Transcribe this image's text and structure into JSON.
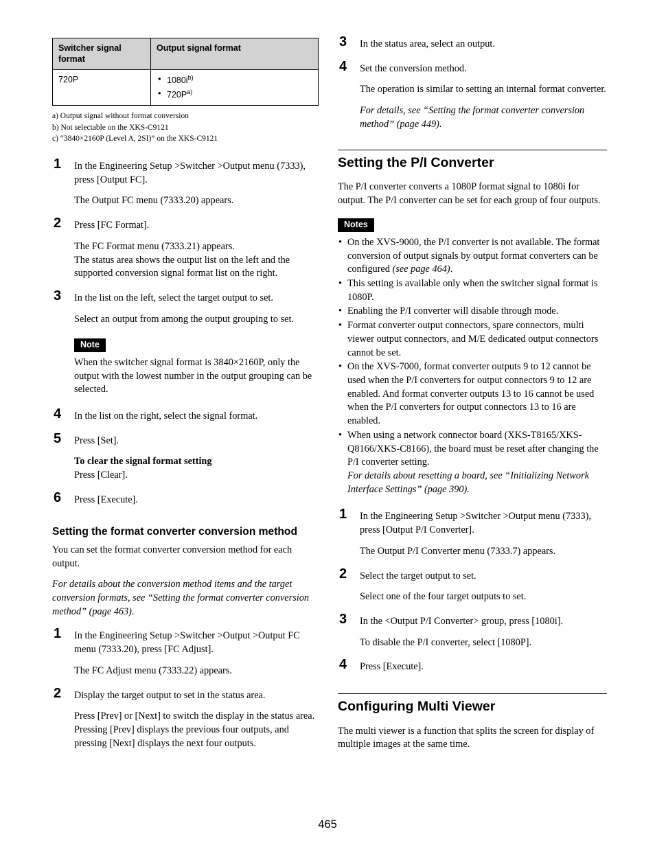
{
  "page_number": "465",
  "table": {
    "headers": [
      "Switcher signal format",
      "Output signal format"
    ],
    "rows": [
      {
        "format": "720P",
        "outputs": [
          {
            "label": "1080i",
            "footnote": "b)"
          },
          {
            "label": "720P",
            "footnote": "a)"
          }
        ]
      }
    ]
  },
  "footnotes": [
    "a) Output signal without format conversion",
    "b) Not selectable on the XKS-C9121",
    "c) “3840×2160P (Level A, 2SI)” on the XKS-C9121"
  ],
  "left_column": {
    "steps_fc_format": [
      {
        "num": "1",
        "text": "In the Engineering Setup >Switcher >Output menu (7333), press [Output FC].",
        "result": "The Output FC menu (7333.20) appears."
      },
      {
        "num": "2",
        "text": "Press [FC Format].",
        "result": "The FC Format menu (7333.21) appears.\nThe status area shows the output list on the left and the supported conversion signal format list on the right."
      },
      {
        "num": "3",
        "text": "In the list on the left, select the target output to set.",
        "result": "Select an output from among the output grouping to set."
      },
      {
        "num": "4",
        "text": "In the list on the right, select the signal format."
      },
      {
        "num": "5",
        "text": "Press [Set]."
      },
      {
        "num": "6",
        "text": "Press [Execute]."
      }
    ],
    "note": {
      "badge": "Note",
      "body": "When the switcher signal format is 3840×2160P, only the output with the lowest number in the output grouping can be selected."
    },
    "clear_setting": {
      "heading": "To clear the signal format setting",
      "body": "Press [Clear]."
    },
    "subsection": {
      "heading": "Setting the format converter conversion method",
      "intro": "You can set the format converter conversion method for each output.",
      "reference": "For details about the conversion method items and the target conversion formats, see “Setting the format converter conversion method” (page 463).",
      "steps": [
        {
          "num": "1",
          "text": "In the Engineering Setup >Switcher >Output >Output FC menu (7333.20), press [FC Adjust].",
          "result": "The FC Adjust menu (7333.22) appears."
        },
        {
          "num": "2",
          "text": "Display the target output to set in the status area.",
          "result": "Press [Prev] or [Next] to switch the display in the status area.\nPressing [Prev] displays the previous four outputs, and pressing [Next] displays the next four outputs."
        }
      ]
    }
  },
  "right_column": {
    "steps_continued": [
      {
        "num": "3",
        "text": "In the status area, select an output."
      },
      {
        "num": "4",
        "text": "Set the conversion method.",
        "result": "The operation is similar to setting an internal format converter.",
        "reference": "For details, see “Setting the format converter conversion method” (page 449)."
      }
    ],
    "section_pi": {
      "heading": "Setting the P/I Converter",
      "intro": "The P/I converter converts a 1080P format signal to 1080i for output. The P/I converter can be set for each group of four outputs.",
      "notes_badge": "Notes",
      "notes": [
        {
          "text": "On the XVS-9000, the P/I converter is not available. The format conversion of output signals by output format converters can be configured ",
          "italic_tail": "(see page 464)",
          "tail": "."
        },
        {
          "text": "This setting is available only when the switcher signal format is 1080P."
        },
        {
          "text": "Enabling the P/I converter will disable through mode."
        },
        {
          "text": "Format converter output connectors, spare connectors, multi viewer output connectors, and M/E dedicated output connectors cannot be set."
        },
        {
          "text": "On the XVS-7000, format converter outputs 9 to 12 cannot be used when the P/I converters for output connectors 9 to 12 are enabled. And format converter outputs 13 to 16 cannot be used when the P/I converters for output connectors 13 to 16 are enabled."
        },
        {
          "text": "When using a network connector board (XKS-T8165/XKS-Q8166/XKS-C8166), the board must be reset after changing the P/I converter setting.",
          "italic_line": "For details about resetting a board, see “Initializing Network Interface Settings” (page 390)."
        }
      ],
      "steps": [
        {
          "num": "1",
          "text": "In the Engineering Setup >Switcher >Output menu (7333), press [Output P/I Converter].",
          "result": "The Output P/I Converter menu (7333.7) appears."
        },
        {
          "num": "2",
          "text": "Select the target output to set.",
          "result": "Select one of the four target outputs to set."
        },
        {
          "num": "3",
          "text": "In the <Output P/I Converter> group, press [1080i].",
          "result": "To disable the P/I converter, select [1080P]."
        },
        {
          "num": "4",
          "text": "Press [Execute]."
        }
      ]
    },
    "section_mv": {
      "heading": "Configuring Multi Viewer",
      "intro": "The multi viewer is a function that splits the screen for display of multiple images at the same time."
    }
  }
}
